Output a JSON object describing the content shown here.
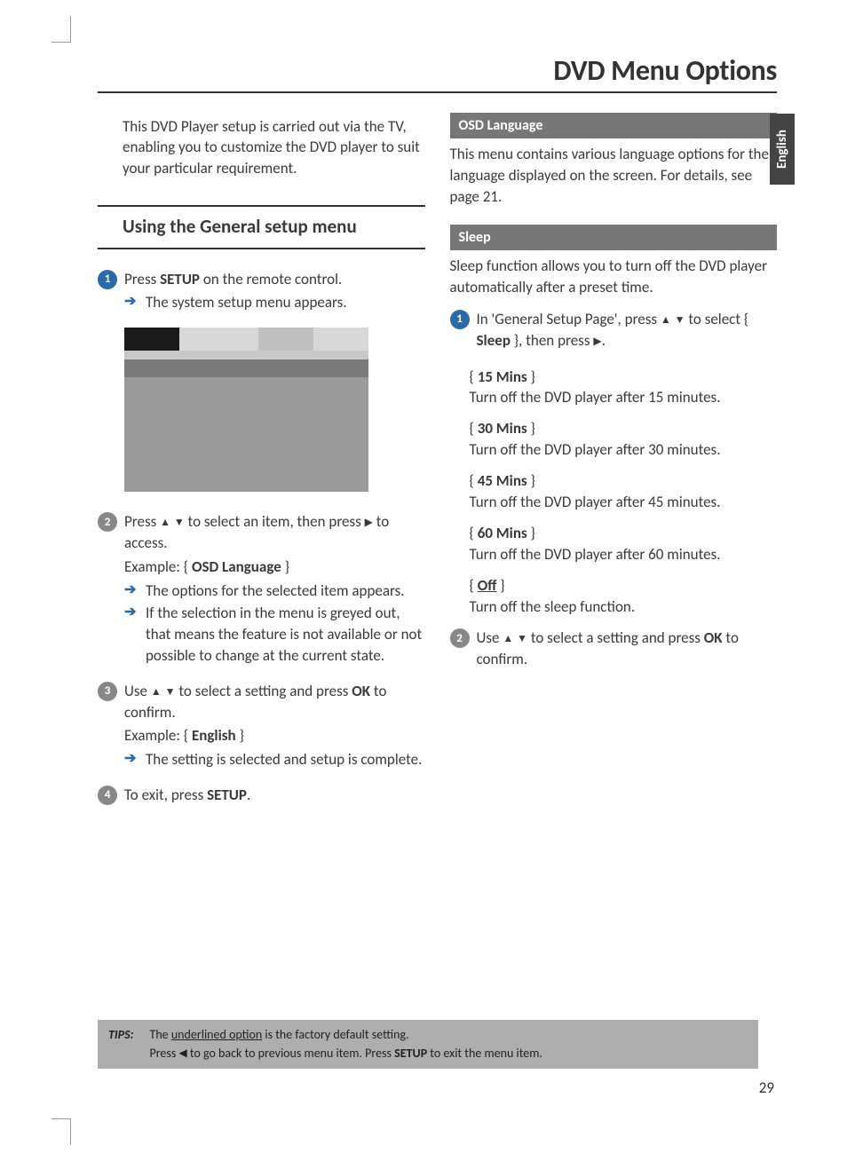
{
  "title": "DVD Menu Options",
  "langTab": "English",
  "intro": "This DVD Player setup is carried out via the TV, enabling you to customize the DVD player to suit your particular requirement.",
  "sectionHeading": "Using the General setup menu",
  "steps": {
    "s1": {
      "line": {
        "pre": "Press ",
        "b": "SETUP",
        "post": " on the remote control."
      },
      "sub1": "The system setup menu appears."
    },
    "s2": {
      "pre": "Press ",
      "mid": " to select an item, then press ",
      "post": " to access.",
      "ex": {
        "pre": "Example: { ",
        "b": "OSD Language",
        "post": " }"
      },
      "sub1": "The options for the selected item appears.",
      "sub2": "If the selection in the menu is greyed out, that means the feature is not available or not possible to change at the current state."
    },
    "s3": {
      "pre": "Use ",
      "mid": " to select a setting and press ",
      "b": "OK",
      "post": " to confirm.",
      "ex": {
        "pre": "Example: { ",
        "b": "English",
        "post": " }"
      },
      "sub1": "The setting is selected and setup is complete."
    },
    "s4": {
      "pre": "To exit, press ",
      "b": "SETUP",
      "post": "."
    }
  },
  "osd": {
    "hdr": "OSD Language",
    "body": "This menu contains various language options for the language displayed on the screen. For details, see page 21."
  },
  "sleep": {
    "hdr": "Sleep",
    "body": "Sleep function allows you to turn off the DVD player automatically after a preset time.",
    "step1": {
      "pre": "In 'General Setup Page', press ",
      "mid": " to select { ",
      "b": "Sleep",
      "mid2": " }, then press ",
      "post": "."
    },
    "opt15": {
      "label": "15 Mins",
      "desc": "Turn off the DVD player after 15 minutes."
    },
    "opt30": {
      "label": "30 Mins",
      "desc": "Turn off the DVD player after 30 minutes."
    },
    "opt45": {
      "label": "45 Mins",
      "desc": "Turn off the DVD player after 45 minutes."
    },
    "opt60": {
      "label": "60 Mins",
      "desc": "Turn off the DVD player after 60 minutes."
    },
    "optOff": {
      "label": "Off",
      "desc": "Turn off the sleep function."
    },
    "step2": {
      "pre": "Use ",
      "mid": " to select a setting and press ",
      "b": "OK",
      "post": " to confirm."
    }
  },
  "tips": {
    "label": "TIPS:",
    "line1a": "The ",
    "line1u": "underlined option",
    "line1b": " is the factory default setting.",
    "line2a": "Press ",
    "line2b": " to go back to previous menu item. Press ",
    "line2c": "SETUP",
    "line2d": " to exit the menu item."
  },
  "pageNum": "29"
}
